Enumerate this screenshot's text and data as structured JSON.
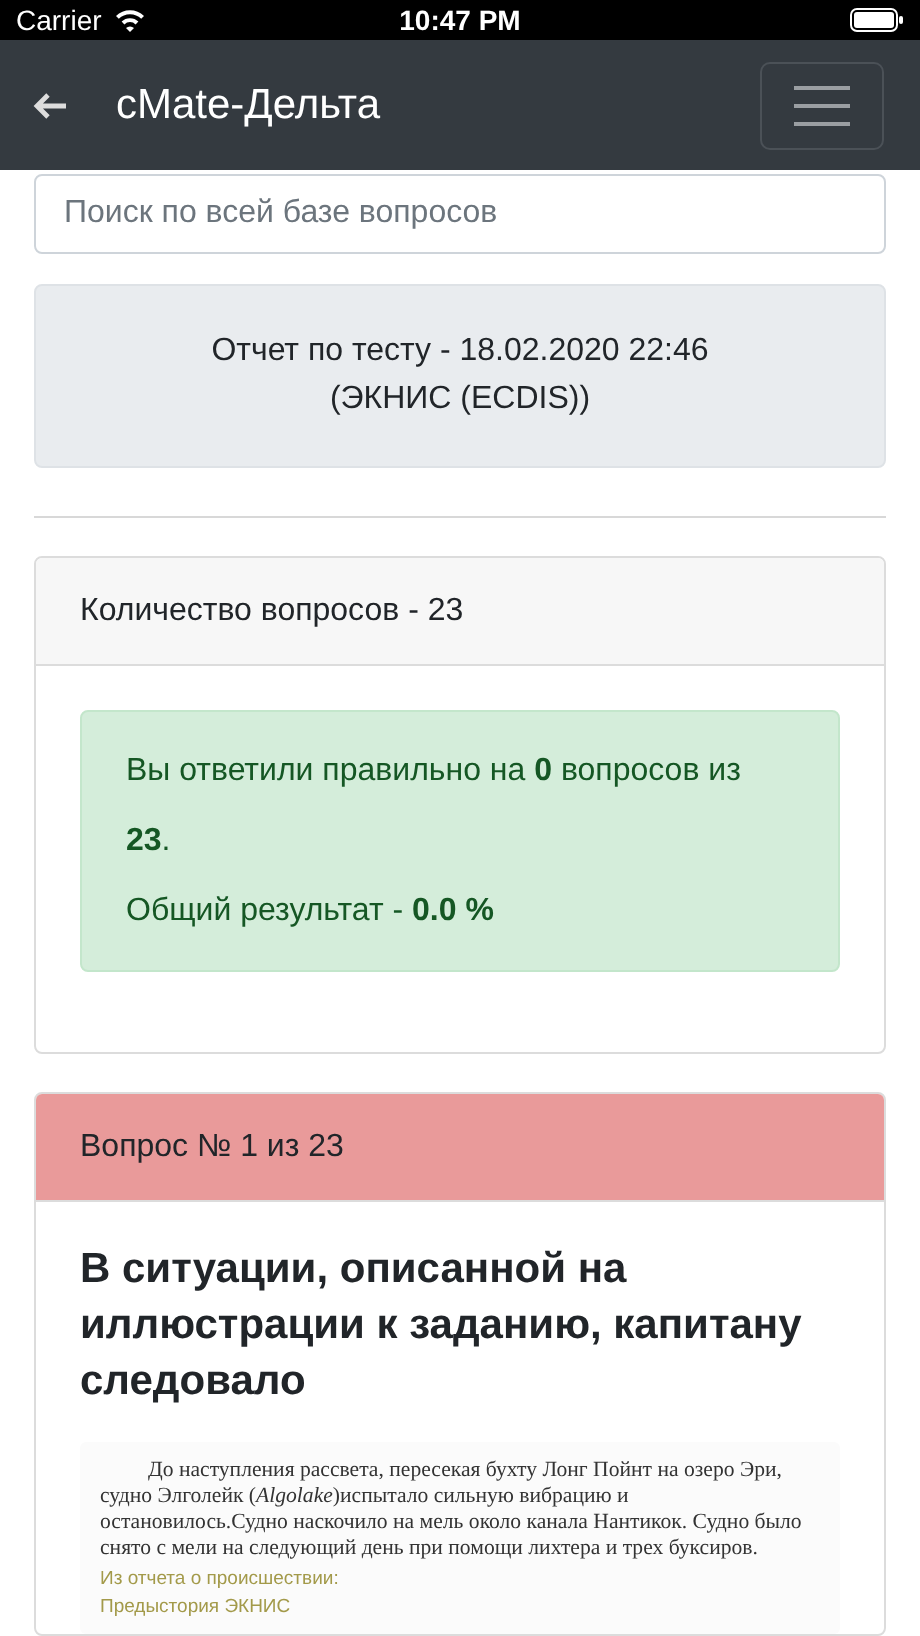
{
  "status_bar": {
    "carrier": "Carrier",
    "time": "10:47 PM"
  },
  "nav": {
    "title": "cMate-Дельта"
  },
  "search": {
    "placeholder": "Поиск по всей базе вопросов"
  },
  "report": {
    "lines": [
      "Отчет по тесту - 18.02.2020 22:46",
      "(ЭКНИС (ECDIS))"
    ]
  },
  "summary": {
    "header": "Количество вопросов - 23",
    "result_lines": [
      "Вы ответили правильно на **0** вопросов из **23**.",
      "Общий результат - **0.0 %**"
    ]
  },
  "question": {
    "header": "Вопрос № 1 из 23",
    "correct": false,
    "text": "В ситуации, описанной на иллюстрации к заданию, капитану следовало",
    "illustration": {
      "paragraph": "До наступления рассвета, пересекая бухту Лонг Пойнт на озеро Эри, судно Элголейк (*Algolake*)испытало сильную вибрацию и остановилось.Судно наскочило на мель около канала Нантикок. Судно было снято с мели на следующий день при помощи лихтера и трех буксиров.",
      "notes": [
        "Из отчета о происшествии:",
        "Предыстория ЭКНИС"
      ]
    }
  }
}
